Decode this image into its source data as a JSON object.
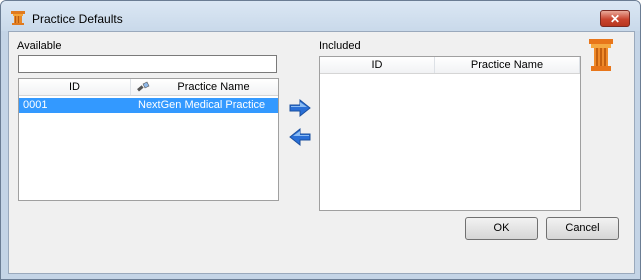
{
  "window": {
    "title": "Practice Defaults",
    "close_glyph": "✕"
  },
  "available": {
    "label": "Available",
    "search_value": "",
    "columns": {
      "id": "ID",
      "name": "Practice Name"
    },
    "rows": [
      {
        "id": "0001",
        "name": "NextGen Medical Practice",
        "selected": true
      }
    ]
  },
  "included": {
    "label": "Included",
    "columns": {
      "id": "ID",
      "name": "Practice Name"
    },
    "rows": []
  },
  "buttons": {
    "ok": "OK",
    "cancel": "Cancel"
  },
  "icons": {
    "add": "arrow-right-icon",
    "remove": "arrow-left-icon",
    "app": "pillar-icon",
    "sort": "flashlight-icon"
  },
  "colors": {
    "selection": "#3399ff",
    "arrow": "#2a6fd6"
  }
}
